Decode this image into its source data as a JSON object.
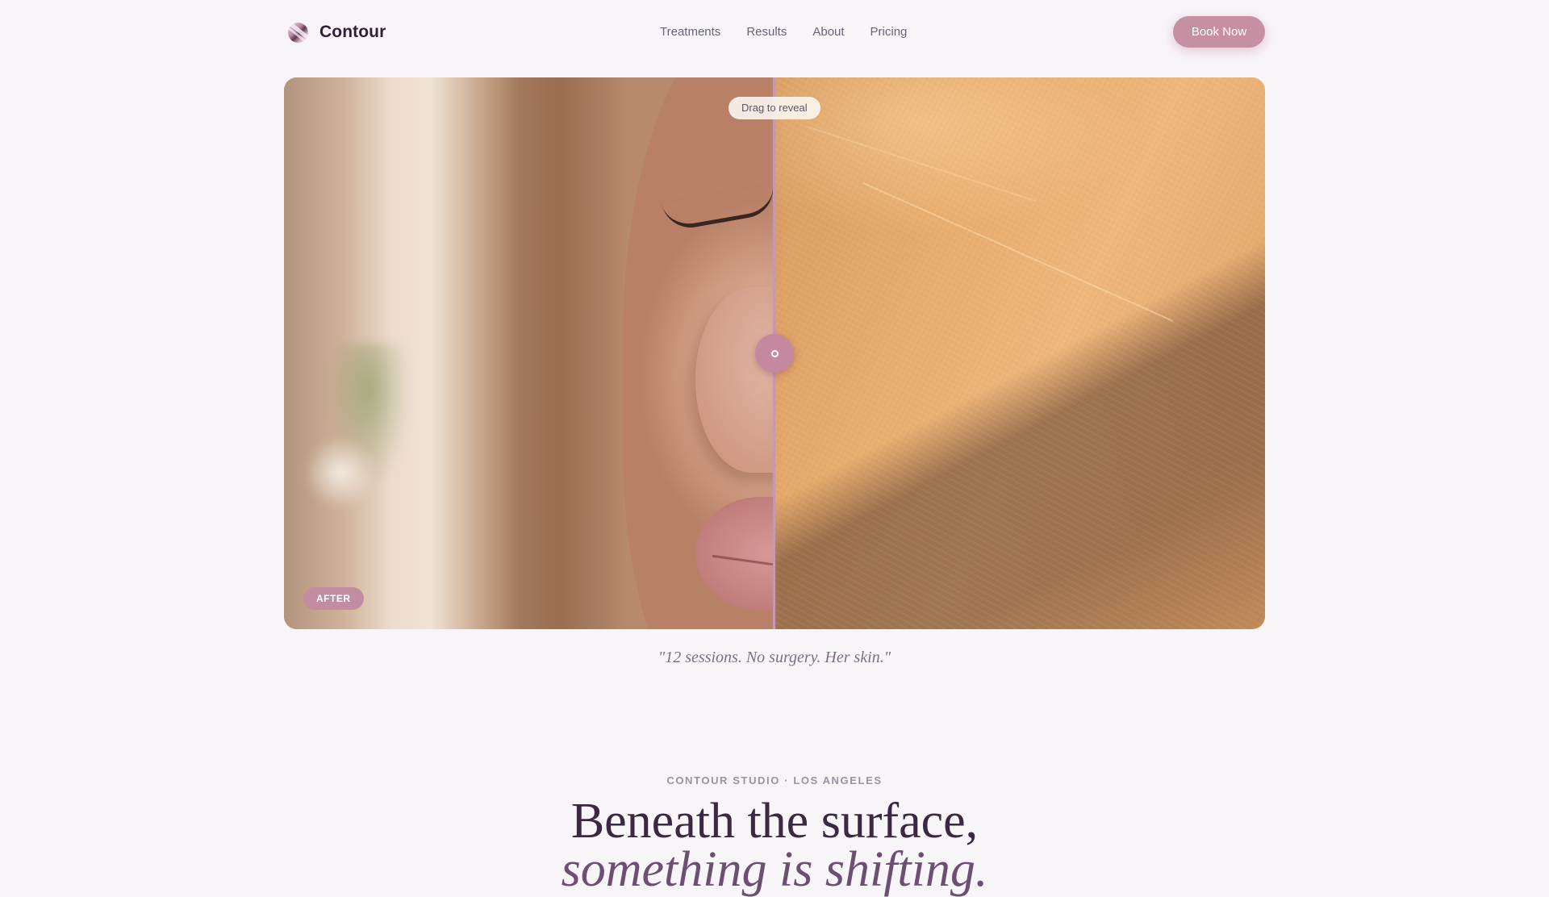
{
  "nav": {
    "brand": "Contour",
    "links": [
      "Treatments",
      "Results",
      "About",
      "Pricing"
    ],
    "cta": "Book Now"
  },
  "compare": {
    "drag_hint": "Drag to reveal",
    "after_label": "AFTER",
    "divider_position": 0.5
  },
  "quote": "\"12 sessions. No surgery. Her skin.\"",
  "intro": {
    "eyebrow": "CONTOUR STUDIO · LOS ANGELES",
    "headline_line1": "Beneath the surface,",
    "headline_line2": "something is shifting."
  }
}
